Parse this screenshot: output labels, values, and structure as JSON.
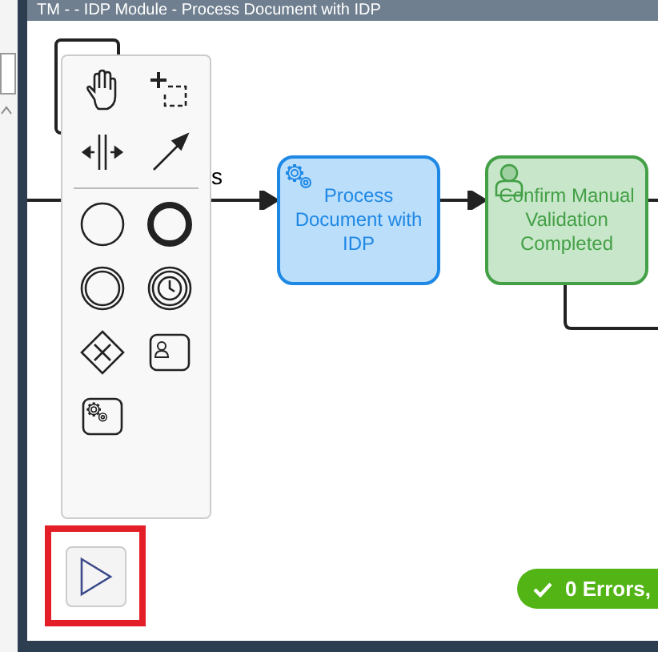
{
  "window": {
    "title": "TM - - IDP Module - Process Document with IDP"
  },
  "canvas": {
    "flow_label": "s",
    "tasks": [
      {
        "kind": "service",
        "label": "Process Document with IDP"
      },
      {
        "kind": "user",
        "label": "Confirm Manual Validation Completed"
      }
    ]
  },
  "status_badge": {
    "text": "0 Errors,"
  }
}
